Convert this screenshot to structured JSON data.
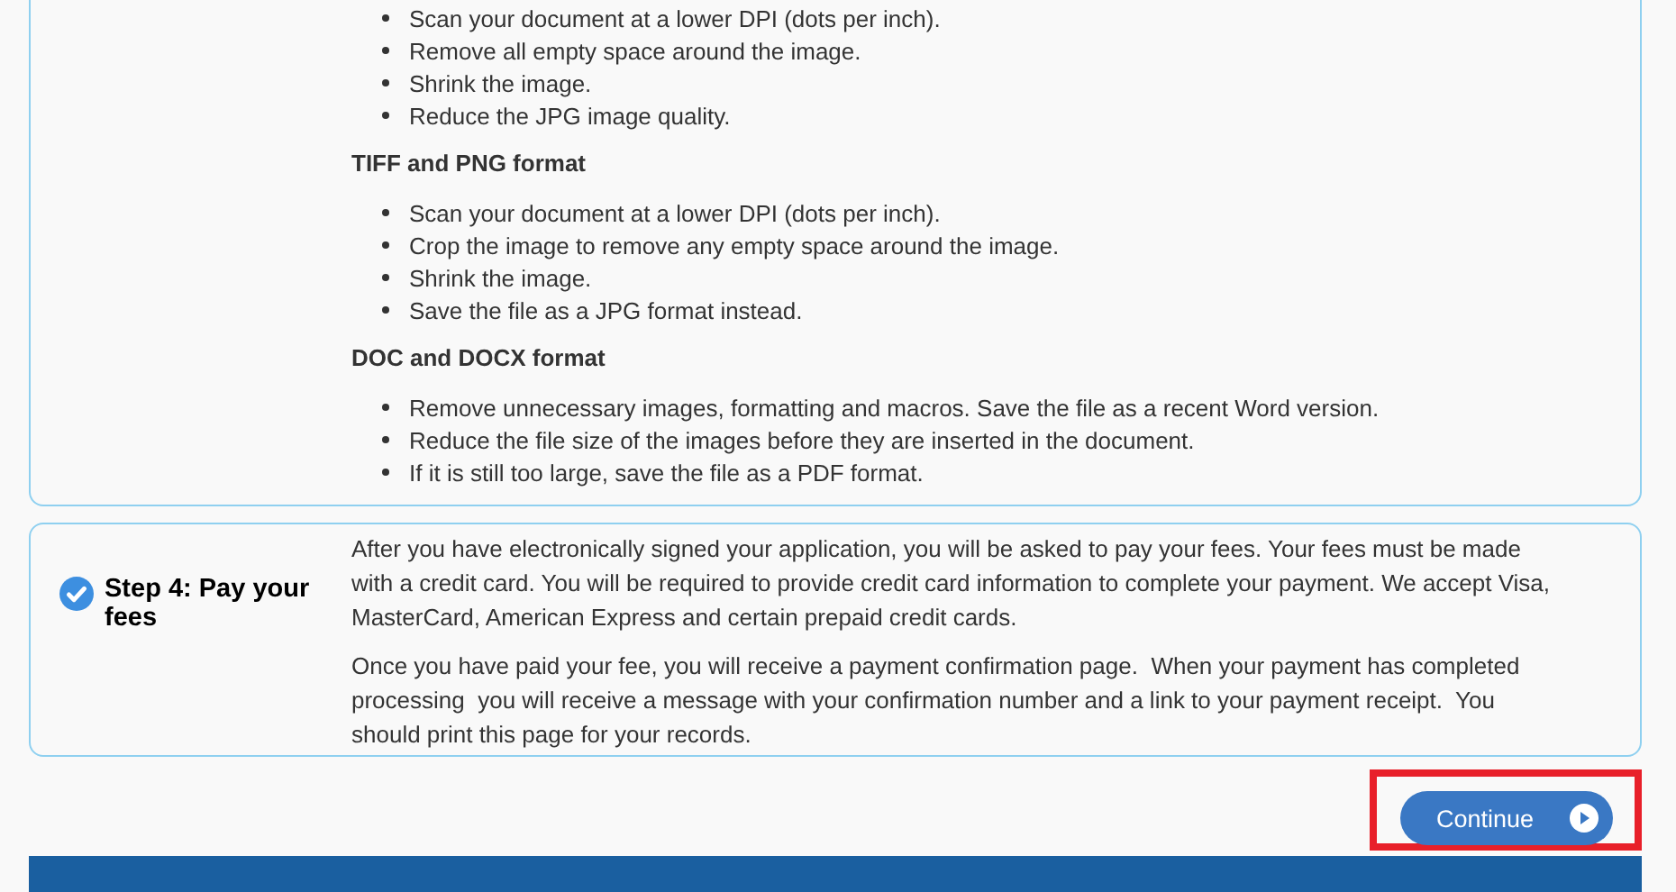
{
  "tips_card": {
    "sections": [
      {
        "items": [
          "Scan your document at a lower DPI (dots per inch).",
          "Remove all empty space around the image.",
          "Shrink the image.",
          "Reduce the JPG image quality."
        ]
      },
      {
        "heading": "TIFF and PNG format",
        "items": [
          "Scan your document at a lower DPI (dots per inch).",
          "Crop the image to remove any empty space around the image.",
          "Shrink the image.",
          "Save the file as a JPG format instead."
        ]
      },
      {
        "heading": "DOC and DOCX format",
        "items": [
          "Remove unnecessary images, formatting and macros. Save the file as a recent Word version.",
          "Reduce the file size of the images before they are inserted in the document.",
          "If it is still too large, save the file as a PDF format."
        ]
      }
    ]
  },
  "step": {
    "title": "Step 4: Pay your fees",
    "completed": true,
    "paragraphs": [
      "After you have electronically signed your application, you will be asked to pay your fees. Your fees must be made with a credit card. You will be required to provide credit card information to complete your payment. We accept Visa, MasterCard, American Express and certain prepaid credit cards.",
      "Once you have paid your fee, you will receive a payment confirmation page.  When your payment has completed processing  you will receive a message with your confirmation number and a link to your payment receipt.  You should print this page for your records."
    ]
  },
  "continue_button": {
    "label": "Continue",
    "highlighted": true
  }
}
